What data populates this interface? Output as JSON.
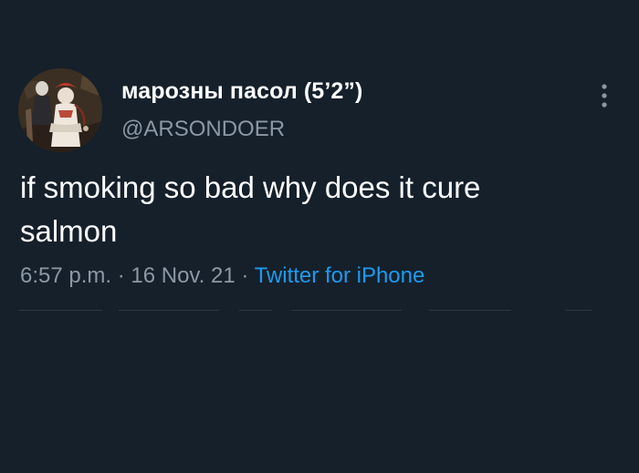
{
  "tweet": {
    "display_name": "марозны пасол (5’2”)",
    "handle": "@ARSONDOER",
    "text_line1": "if smoking so bad why does it cure",
    "text_line2": "salmon",
    "time": "6:57 p.m.",
    "separator": " · ",
    "date": "16 Nov. 21",
    "source": "Twitter for iPhone"
  },
  "icons": {
    "avatar": "profile-picture",
    "more": "more-vertical-icon"
  },
  "colors": {
    "background": "#15202b",
    "primary_text": "#ffffff",
    "secondary_text": "#8b98a5",
    "link": "#1d9bf0"
  }
}
